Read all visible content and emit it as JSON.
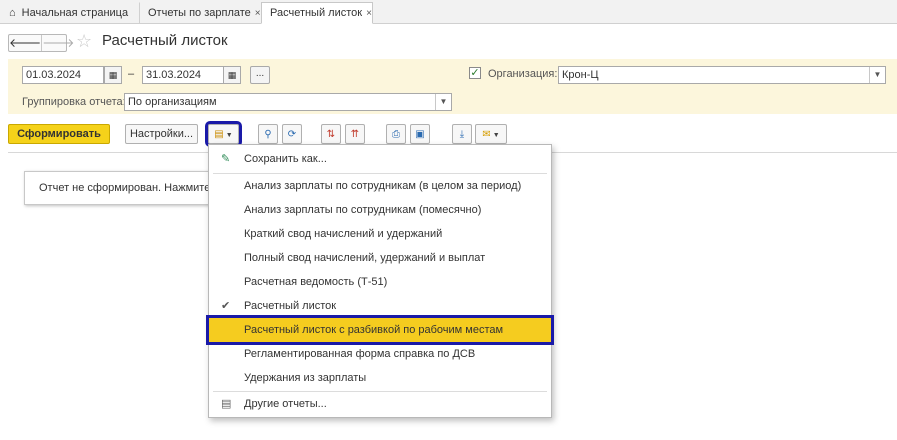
{
  "tabs": [
    {
      "label": "Начальная страница"
    },
    {
      "label": "Отчеты по зарплате",
      "close": "×"
    },
    {
      "label": "Расчетный листок",
      "close": "×"
    }
  ],
  "nav": {
    "back": "🡐",
    "forward": "🡒"
  },
  "title": "Расчетный листок",
  "filters": {
    "date_from": "01.03.2024",
    "date_to": "31.03.2024",
    "dash": "–",
    "dots": "...",
    "org_checked": true,
    "org_label": "Организация:",
    "org_value": "Крон-Ц",
    "group_label": "Группировка отчета:",
    "group_value": "По организациям"
  },
  "toolbar": {
    "generate": "Сформировать",
    "settings": "Настройки..."
  },
  "notice": "Отчет не сформирован. Нажмите \"Сформировать\"",
  "menu": {
    "save_as": "Сохранить как...",
    "items": [
      "Анализ зарплаты по сотрудникам (в целом за период)",
      "Анализ зарплаты по сотрудникам (помесячно)",
      "Краткий свод начислений и удержаний",
      "Полный свод начислений, удержаний и выплат",
      "Расчетная ведомость (Т-51)",
      "Расчетный листок",
      "Расчетный листок с разбивкой по рабочим местам",
      "Регламентированная форма справка по ДСВ",
      "Удержания из зарплаты"
    ],
    "checked_item": "Расчетный листок",
    "selected_item": "Расчетный листок с разбивкой по рабочим местам",
    "other_reports": "Другие отчеты..."
  },
  "colors": {
    "accent": "#f5d21a",
    "highlight_border": "#1a1aa8",
    "filter_bg": "#fcf6dc"
  }
}
